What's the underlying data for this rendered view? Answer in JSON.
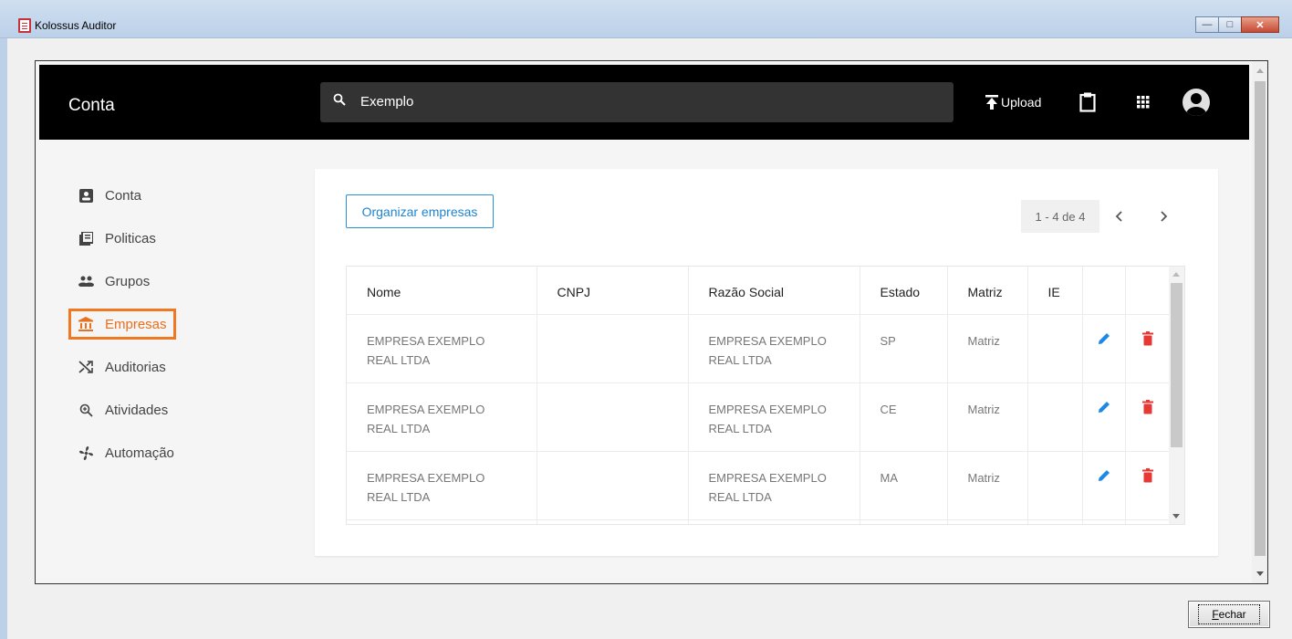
{
  "window": {
    "title": "Kolossus Auditor",
    "controls": [
      "minimize",
      "maximize",
      "close"
    ]
  },
  "appbar": {
    "title": "Conta",
    "search_value": "Exemplo",
    "upload_label": "Upload",
    "icons": [
      "search-icon",
      "upload-icon",
      "clipboard-icon",
      "apps-grid-icon",
      "account-avatar"
    ]
  },
  "sidebar": {
    "items": [
      {
        "label": "Conta",
        "icon": "account-box-icon"
      },
      {
        "label": "Politicas",
        "icon": "library-books-icon"
      },
      {
        "label": "Grupos",
        "icon": "group-icon"
      },
      {
        "label": "Empresas",
        "icon": "bank-icon",
        "active": true
      },
      {
        "label": "Auditorias",
        "icon": "shuffle-icon"
      },
      {
        "label": "Atividades",
        "icon": "zoom-icon"
      },
      {
        "label": "Automação",
        "icon": "fan-icon"
      }
    ]
  },
  "main": {
    "organize_button": "Organizar empresas",
    "pagination": "1 - 4 de 4",
    "table": {
      "headers": [
        "Nome",
        "CNPJ",
        "Razão Social",
        "Estado",
        "Matriz",
        "IE"
      ],
      "rows": [
        {
          "nome_1": "EMPRESA EXEMPLO",
          "nome_2": "REAL LTDA",
          "cnpj": "",
          "razao_1": "EMPRESA EXEMPLO",
          "razao_2": "REAL LTDA",
          "estado": "SP",
          "matriz": "Matriz",
          "ie": ""
        },
        {
          "nome_1": "EMPRESA EXEMPLO",
          "nome_2": "REAL LTDA",
          "cnpj": "",
          "razao_1": "EMPRESA EXEMPLO",
          "razao_2": "REAL LTDA",
          "estado": "CE",
          "matriz": "Matriz",
          "ie": ""
        },
        {
          "nome_1": "EMPRESA EXEMPLO",
          "nome_2": "REAL LTDA",
          "cnpj": "",
          "razao_1": "EMPRESA EXEMPLO",
          "razao_2": "REAL LTDA",
          "estado": "MA",
          "matriz": "Matriz",
          "ie": ""
        }
      ]
    }
  },
  "footer": {
    "close_button_accel": "F",
    "close_button_rest": "echar"
  },
  "colors": {
    "accent_orange": "#f07822",
    "link_blue": "#1e84d0",
    "edit_blue": "#1e88e5",
    "delete_red": "#e53935",
    "appbar_bg": "#000000"
  }
}
